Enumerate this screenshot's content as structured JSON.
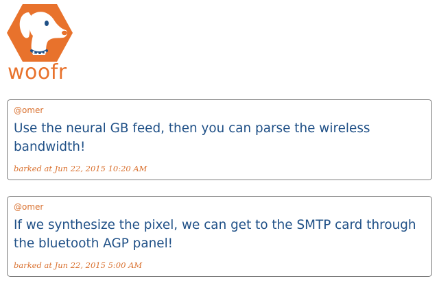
{
  "app": {
    "brand": "woofr",
    "logo_icon": "dog-head-icon",
    "colors": {
      "brand_orange": "#e8722c",
      "text_blue": "#1e4f86",
      "border_gray": "#7a7a7a"
    }
  },
  "barks": [
    {
      "user": "@omer",
      "text": "Use the neural GB feed, then you can parse the wireless bandwidth!",
      "timestamp": "barked at Jun 22, 2015 10:20 AM"
    },
    {
      "user": "@omer",
      "text": "If we synthesize the pixel, we can get to the SMTP card through the bluetooth AGP panel!",
      "timestamp": "barked at Jun 22, 2015 5:00 AM"
    }
  ]
}
